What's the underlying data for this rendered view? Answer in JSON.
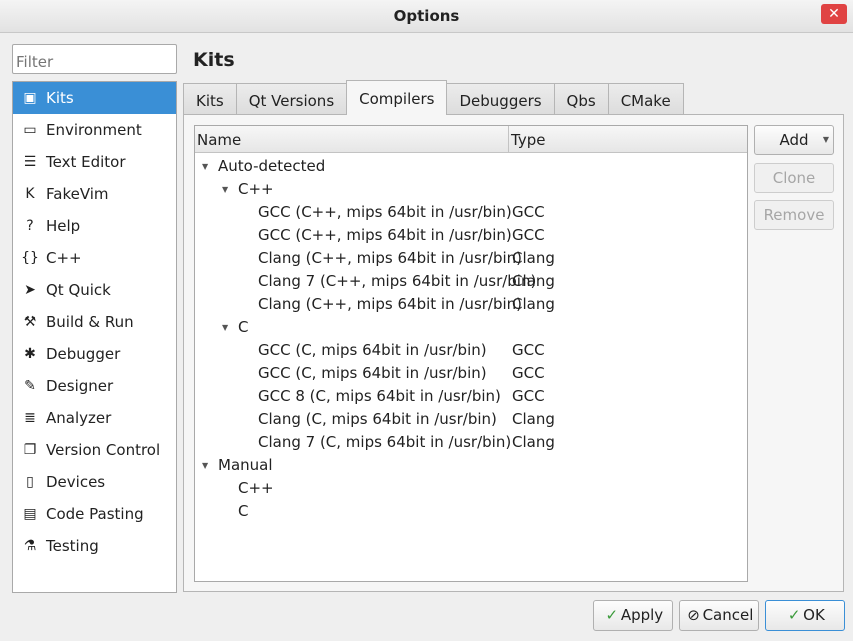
{
  "window": {
    "title": "Options",
    "close_glyph": "✕"
  },
  "filter": {
    "placeholder": "Filter"
  },
  "sidebar": {
    "items": [
      {
        "label": "Kits",
        "icon": "kits-icon",
        "glyph": "▣",
        "selected": true
      },
      {
        "label": "Environment",
        "icon": "monitor-icon",
        "glyph": "▭"
      },
      {
        "label": "Text Editor",
        "icon": "text-editor-icon",
        "glyph": "☰"
      },
      {
        "label": "FakeVim",
        "icon": "fakevim-icon",
        "glyph": "K"
      },
      {
        "label": "Help",
        "icon": "help-icon",
        "glyph": "?"
      },
      {
        "label": "C++",
        "icon": "cpp-braces-icon",
        "glyph": "{}"
      },
      {
        "label": "Qt Quick",
        "icon": "qt-quick-icon",
        "glyph": "➤"
      },
      {
        "label": "Build & Run",
        "icon": "hammer-icon",
        "glyph": "⚒"
      },
      {
        "label": "Debugger",
        "icon": "bug-icon",
        "glyph": "✱"
      },
      {
        "label": "Designer",
        "icon": "pencil-icon",
        "glyph": "✎"
      },
      {
        "label": "Analyzer",
        "icon": "analyzer-icon",
        "glyph": "≣"
      },
      {
        "label": "Version Control",
        "icon": "version-control-icon",
        "glyph": "❐"
      },
      {
        "label": "Devices",
        "icon": "devices-icon",
        "glyph": "▯"
      },
      {
        "label": "Code Pasting",
        "icon": "code-pasting-icon",
        "glyph": "▤"
      },
      {
        "label": "Testing",
        "icon": "testing-icon",
        "glyph": "⚗"
      }
    ]
  },
  "page_title": "Kits",
  "tabs": [
    {
      "label": "Kits",
      "active": false
    },
    {
      "label": "Qt Versions",
      "active": false
    },
    {
      "label": "Compilers",
      "active": true
    },
    {
      "label": "Debuggers",
      "active": false
    },
    {
      "label": "Qbs",
      "active": false
    },
    {
      "label": "CMake",
      "active": false
    }
  ],
  "tree": {
    "columns": {
      "name": "Name",
      "type": "Type"
    },
    "expanded_glyph": "▼",
    "rows": [
      {
        "name": "Auto-detected",
        "type": "",
        "level": 0,
        "expander": true
      },
      {
        "name": "C++",
        "type": "",
        "level": 1,
        "expander": true
      },
      {
        "name": "GCC (C++, mips 64bit in /usr/bin)",
        "type": "GCC",
        "level": 2,
        "expander": false
      },
      {
        "name": "GCC (C++, mips 64bit in /usr/bin)",
        "type": "GCC",
        "level": 2,
        "expander": false
      },
      {
        "name": "Clang (C++, mips 64bit in /usr/bin)",
        "type": "Clang",
        "level": 2,
        "expander": false
      },
      {
        "name": "Clang 7 (C++, mips 64bit in /usr/bin)",
        "type": "Clang",
        "level": 2,
        "expander": false
      },
      {
        "name": "Clang (C++, mips 64bit in /usr/bin)",
        "type": "Clang",
        "level": 2,
        "expander": false
      },
      {
        "name": "C",
        "type": "",
        "level": 1,
        "expander": true
      },
      {
        "name": "GCC (C, mips 64bit in /usr/bin)",
        "type": "GCC",
        "level": 2,
        "expander": false
      },
      {
        "name": "GCC (C, mips 64bit in /usr/bin)",
        "type": "GCC",
        "level": 2,
        "expander": false
      },
      {
        "name": "GCC 8 (C, mips 64bit in /usr/bin)",
        "type": "GCC",
        "level": 2,
        "expander": false
      },
      {
        "name": "Clang (C, mips 64bit in /usr/bin)",
        "type": "Clang",
        "level": 2,
        "expander": false
      },
      {
        "name": "Clang 7 (C, mips 64bit in /usr/bin)",
        "type": "Clang",
        "level": 2,
        "expander": false
      },
      {
        "name": "Manual",
        "type": "",
        "level": 0,
        "expander": true
      },
      {
        "name": "C++",
        "type": "",
        "level": 1,
        "expander": false
      },
      {
        "name": "C",
        "type": "",
        "level": 1,
        "expander": false
      }
    ]
  },
  "side_buttons": {
    "add": "Add",
    "add_dropdown_glyph": "▼",
    "clone": "Clone",
    "remove": "Remove"
  },
  "footer": {
    "apply": "Apply",
    "cancel": "Cancel",
    "ok": "OK",
    "check_glyph": "✓",
    "cancel_glyph": "⊘"
  },
  "colors": {
    "selection": "#3a8fd6",
    "close": "#e04343",
    "check": "#3a9a3a"
  }
}
